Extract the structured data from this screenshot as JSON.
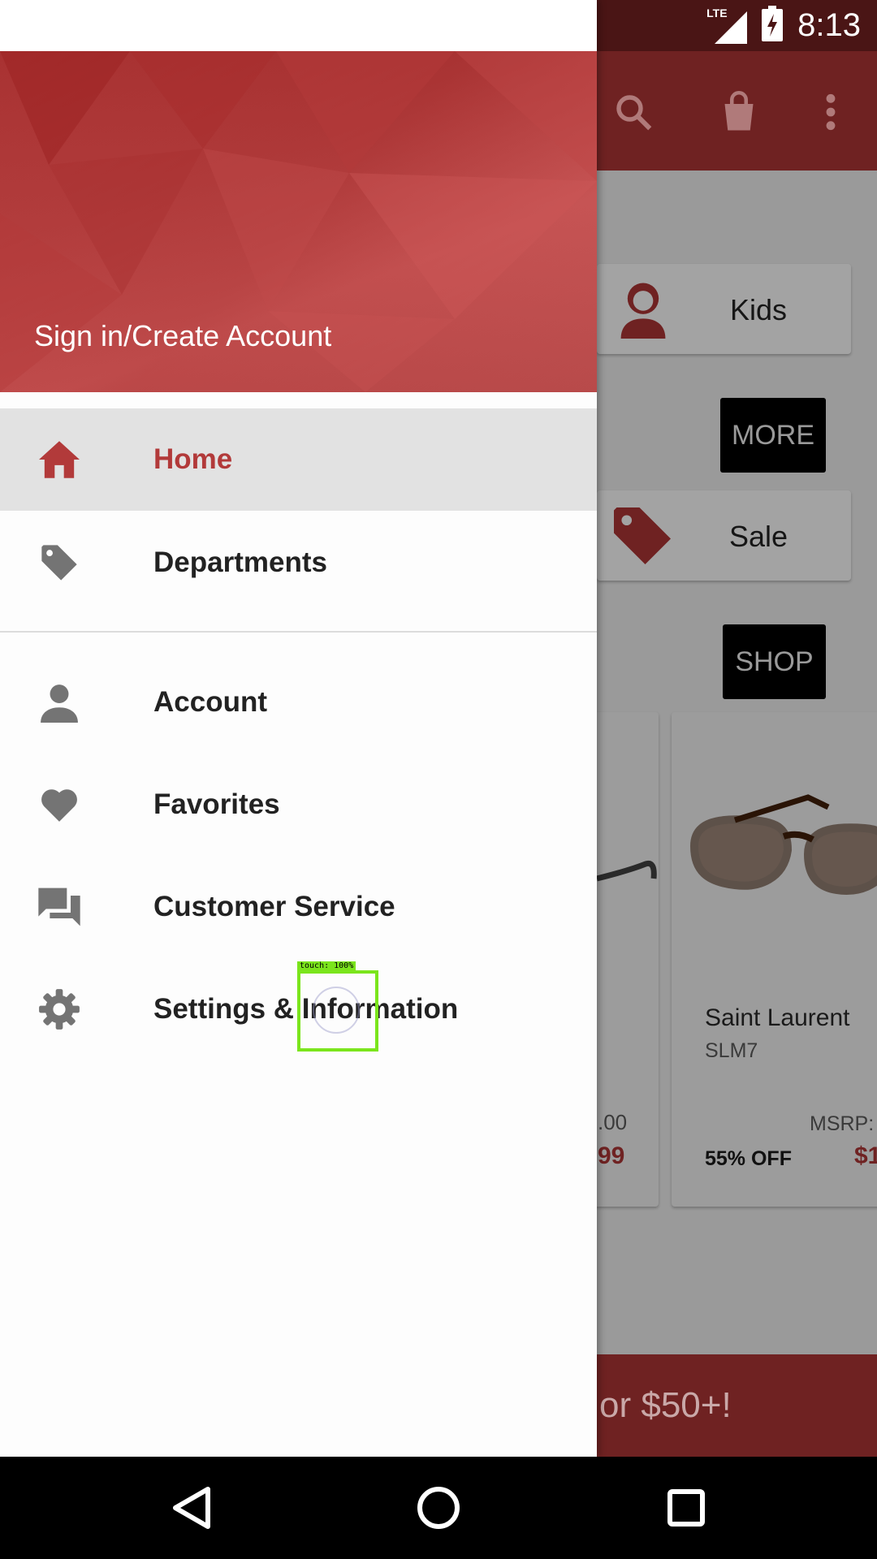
{
  "status_bar": {
    "network": "LTE",
    "time": "8:13"
  },
  "background": {
    "toolbar": {
      "icons": [
        "search-icon",
        "shopping-bag-icon",
        "more-vert-icon"
      ]
    },
    "categories": [
      {
        "label": "Kids",
        "icon": "kid-icon"
      },
      {
        "label": "Sale",
        "icon": "tag-icon"
      }
    ],
    "buttons": {
      "more": "MORE",
      "shop": "SHOP"
    },
    "product_left": {
      "msrp_partial": ".00",
      "price_partial": "99"
    },
    "product_right": {
      "brand": "Saint Laurent",
      "model": "SLM7",
      "msrp_label": "MSRP:",
      "discount": "55% OFF",
      "price_partial": "$1"
    },
    "promo_partial": "or $50+!"
  },
  "drawer": {
    "signin_label": "Sign in/Create Account",
    "primary_items": [
      {
        "label": "Home",
        "icon": "home-icon",
        "selected": true
      },
      {
        "label": "Departments",
        "icon": "tag-icon",
        "selected": false
      }
    ],
    "secondary_items": [
      {
        "label": "Account",
        "icon": "person-icon"
      },
      {
        "label": "Favorites",
        "icon": "heart-icon"
      },
      {
        "label": "Customer Service",
        "icon": "chat-icon"
      },
      {
        "label": "Settings & Information",
        "icon": "gear-icon"
      }
    ]
  },
  "touch_indicator": {
    "label": "touch: 100%"
  },
  "colors": {
    "accent": "#b23a3a",
    "header_red": "#b53838",
    "toolbar_dim": "#6f2222"
  }
}
